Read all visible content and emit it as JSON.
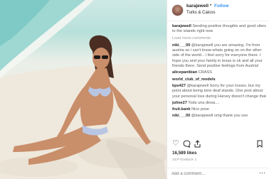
{
  "post": {
    "username": "karajewell",
    "dot": "•",
    "follow_label": "Follow",
    "location": "Turks & Caicos"
  },
  "comments": {
    "caption_user": "karajewell",
    "caption_text": "Sending positive thoughts and good vibes to the islands right now",
    "load_more": "Load more comments",
    "items": [
      {
        "user": "niki___00",
        "text": "@karajewell you are amazing. I'm from austria so i can't know whats going on on the other side of the world... i feel sorry for everyone there. I hope you and your family in texas is ok and all your friends there. Send positive feelings from Austria!"
      },
      {
        "user": "alicepanikian",
        "text": "CRASS"
      },
      {
        "user": "world_club_of_models",
        "text": ""
      },
      {
        "user": "kps427",
        "text": "@karajewell Sorry for your losses..but my point about being tone deaf stands. One post about your personal loss during Harvey doesn't change that"
      },
      {
        "user": "julioe27",
        "text": "Toda una diosa...."
      },
      {
        "user": "fruit.bank",
        "text": "Nice pose"
      },
      {
        "user": "niki___00",
        "text": "@karajewell omg thank you soo"
      }
    ]
  },
  "actions": {
    "like_icon": "heart-icon",
    "comment_icon": "comment-icon",
    "share_icon": "share-icon",
    "bookmark_icon": "bookmark-icon"
  },
  "likes": "16,589 likes",
  "date": "SEPTEMBER 2",
  "add_comment": {
    "placeholder": "Add a comment...",
    "more_icon": "more-options-icon"
  },
  "colors": {
    "link": "#3897f0",
    "text": "#262626",
    "muted": "#999999"
  }
}
